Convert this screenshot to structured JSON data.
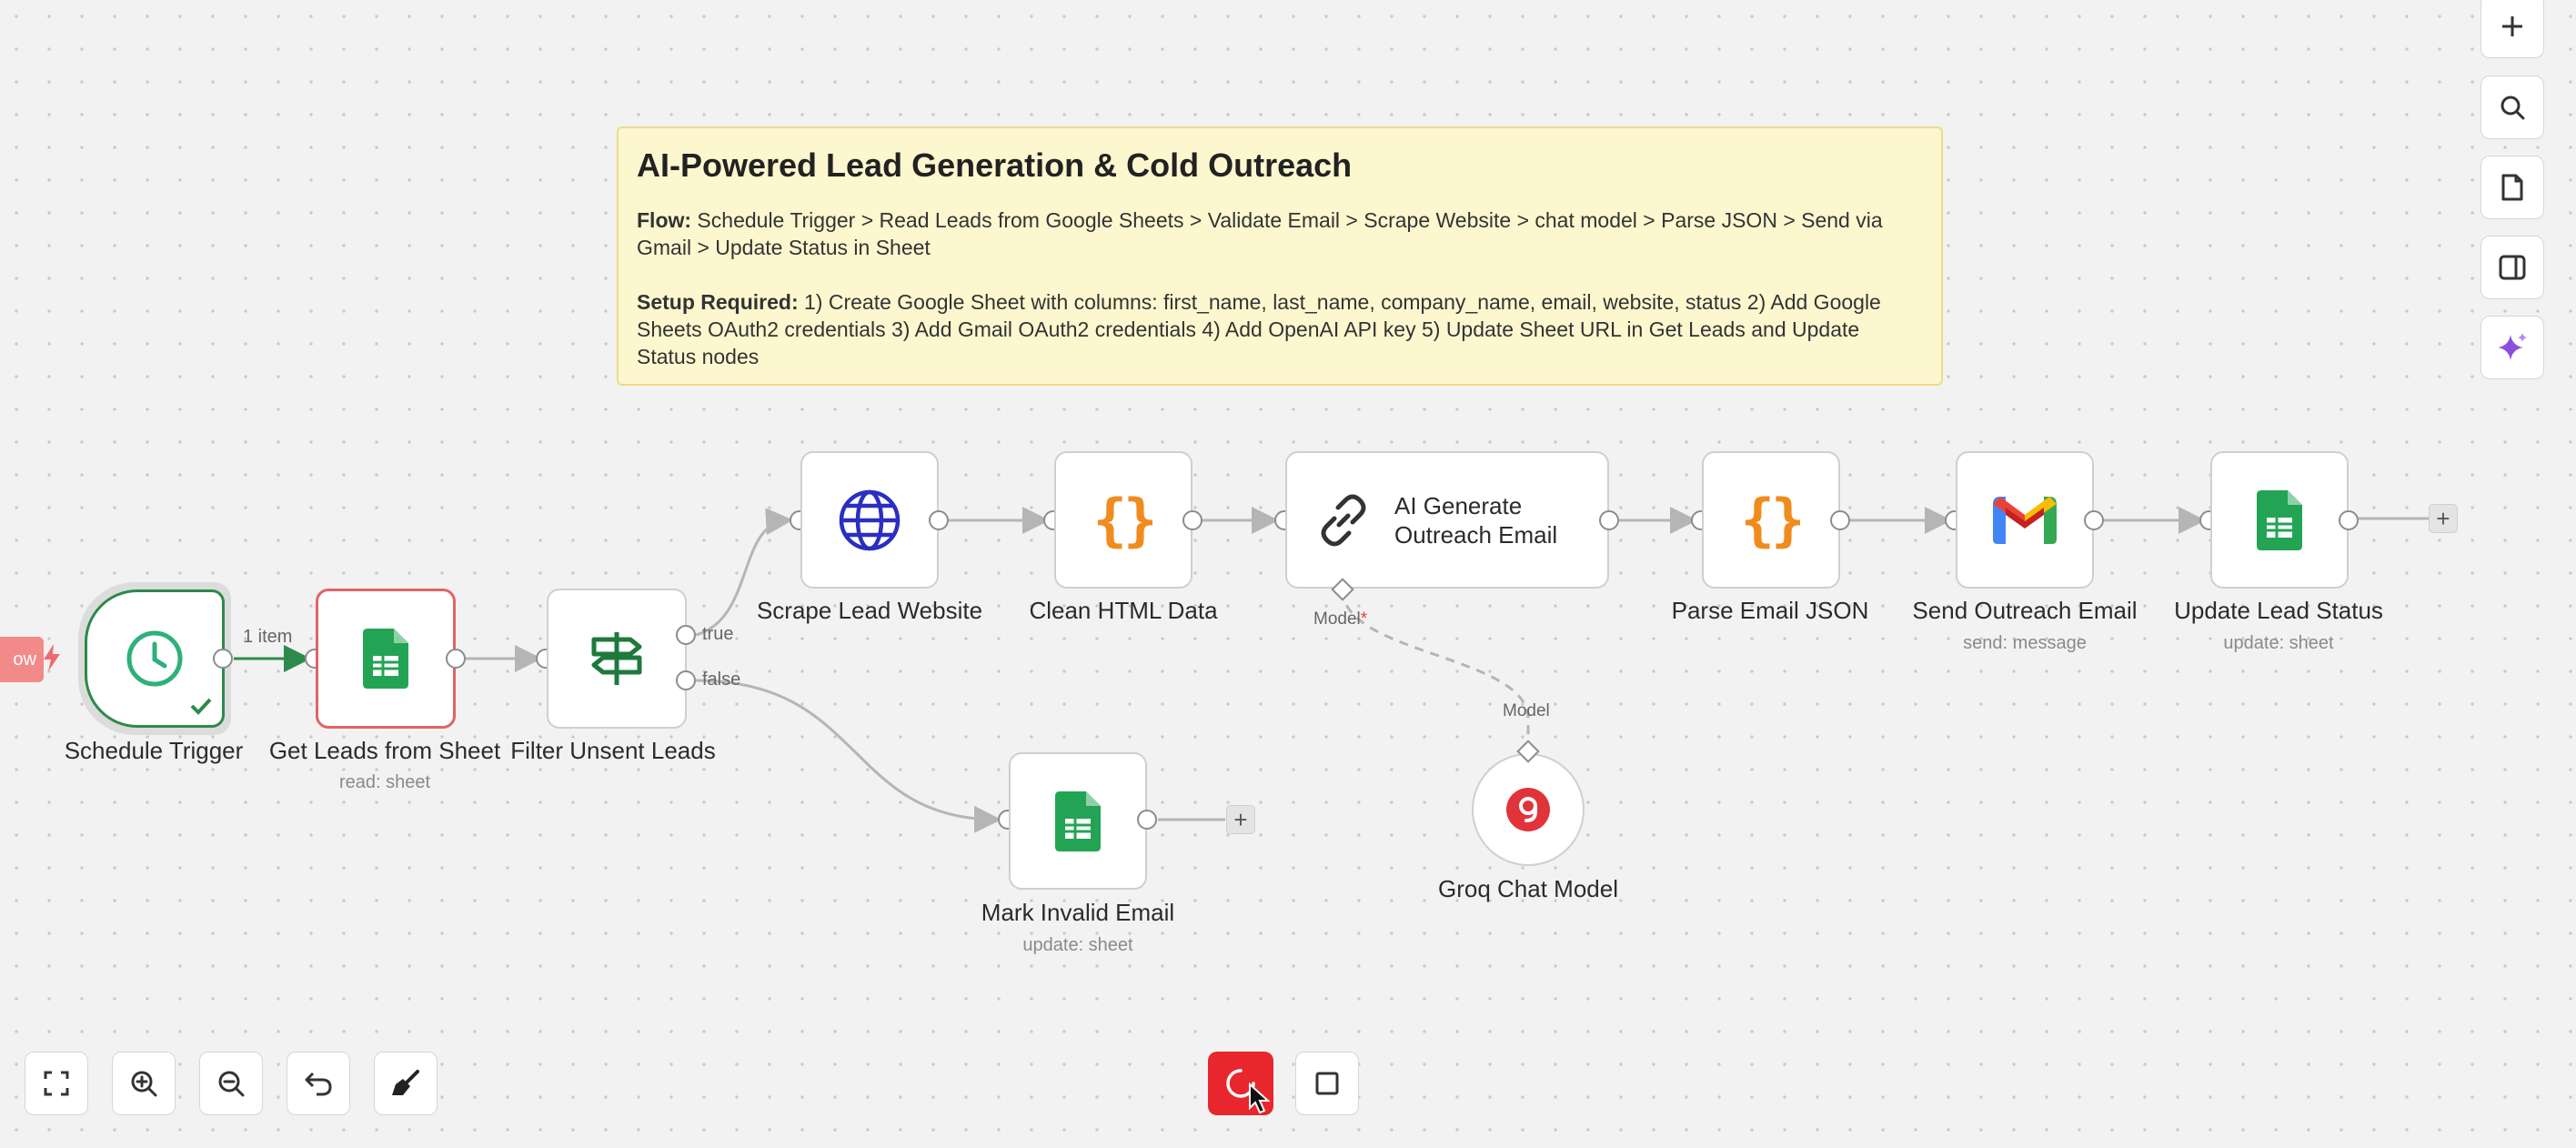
{
  "sticky_note": {
    "title": "AI-Powered Lead Generation & Cold Outreach",
    "flow_label": "Flow:",
    "flow_text": " Schedule Trigger > Read Leads from Google Sheets > Validate Email > Scrape Website > chat model > Parse JSON > Send via Gmail > Update Status in Sheet",
    "setup_label": "Setup Required:",
    "setup_text": " 1) Create Google Sheet with columns: first_name, last_name, company_name, email, website, status 2) Add Google Sheets OAuth2 credentials 3) Add Gmail OAuth2 credentials 4) Add OpenAI API key 5) Update Sheet URL in Get Leads and Update Status nodes"
  },
  "exec_tab": {
    "label": "ow"
  },
  "nodes": {
    "schedule_trigger": {
      "label": "Schedule Trigger",
      "icon": "clock-icon"
    },
    "get_leads": {
      "label": "Get Leads from Sheet",
      "subtitle": "read: sheet",
      "icon": "google-sheets-icon"
    },
    "filter_unsent": {
      "label": "Filter Unsent Leads",
      "icon": "signpost-icon"
    },
    "scrape_website": {
      "label": "Scrape Lead Website",
      "icon": "globe-icon"
    },
    "clean_html": {
      "label": "Clean HTML Data",
      "icon": "code-braces-icon"
    },
    "ai_generate": {
      "label": "AI Generate Outreach Email",
      "icon": "link-icon",
      "model_port_label": "Model"
    },
    "parse_json": {
      "label": "Parse Email JSON",
      "icon": "code-braces-icon"
    },
    "send_email": {
      "label": "Send Outreach Email",
      "subtitle": "send: message",
      "icon": "gmail-icon"
    },
    "update_status": {
      "label": "Update Lead Status",
      "subtitle": "update: sheet",
      "icon": "google-sheets-icon"
    },
    "mark_invalid": {
      "label": "Mark Invalid Email",
      "subtitle": "update: sheet",
      "icon": "google-sheets-icon"
    },
    "groq_model": {
      "label": "Groq Chat Model",
      "port_label": "Model",
      "icon": "groq-icon"
    }
  },
  "edges": {
    "trigger_to_leads_label": "1 item",
    "filter_true_label": "true",
    "filter_false_label": "false"
  },
  "add_buttons": {
    "label": "+"
  },
  "colors": {
    "accent_green": "#2c8a4b",
    "error_red": "#e26464",
    "sheets_green": "#23a454",
    "code_orange": "#f08c1e",
    "globe_blue": "#2b2fbf",
    "sticky_bg": "#fdf7cf",
    "stop_red": "#e8262d"
  },
  "toolbar": {
    "fit_view": "fit-view-icon",
    "zoom_in": "zoom-in-icon",
    "zoom_out": "zoom-out-icon",
    "reset_zoom": "undo-icon",
    "tidy_up": "broom-icon"
  },
  "right_panel": {
    "add_node": "plus-icon",
    "search": "search-icon",
    "sticky": "note-icon",
    "panel_toggle": "panel-icon",
    "ai_assistant": "sparkle-icon"
  },
  "execution_controls": {
    "stop": "stop-spinner-icon",
    "stop_square": "square-icon"
  }
}
